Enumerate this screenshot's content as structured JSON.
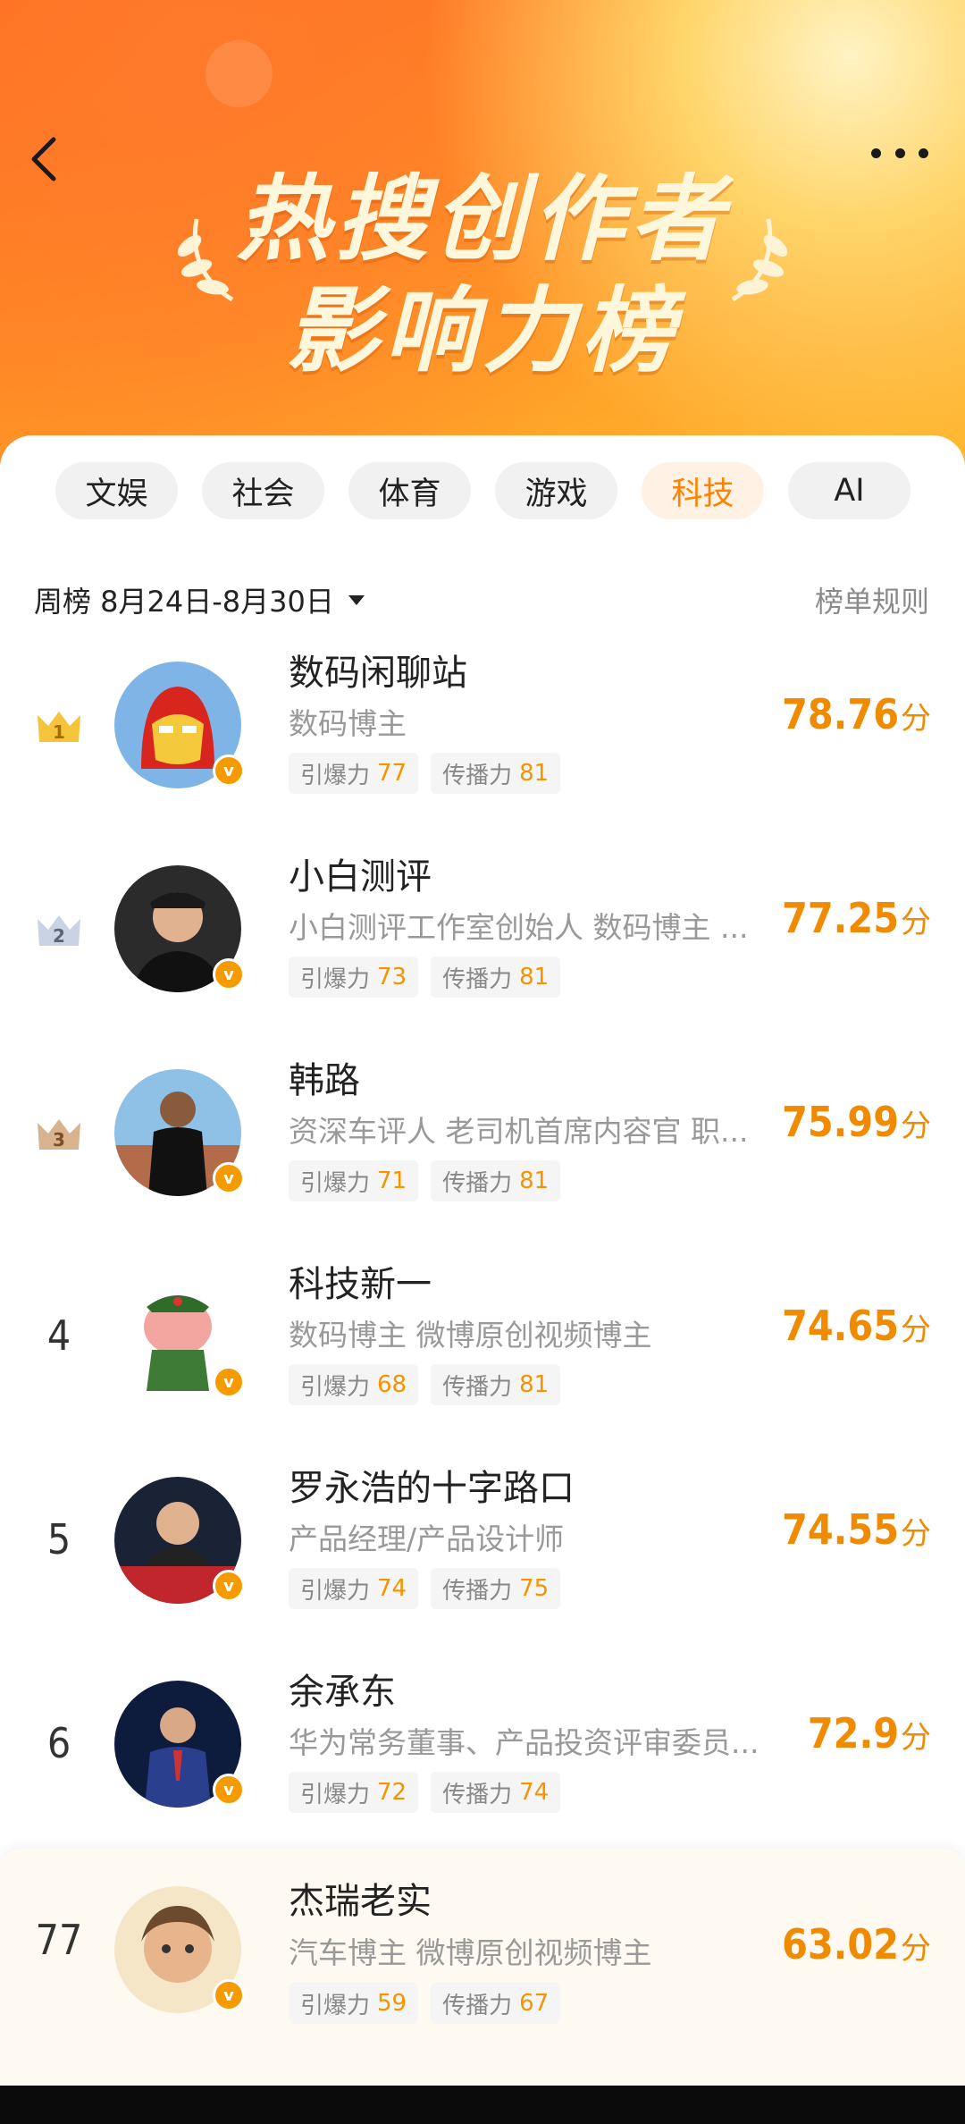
{
  "header": {
    "title_line1": "热搜创作者",
    "title_line2": "影响力榜",
    "back_icon": "chevron-left-icon",
    "more_icon": "more-dots-icon"
  },
  "tabs": [
    {
      "label": "文娱",
      "active": false
    },
    {
      "label": "社会",
      "active": false
    },
    {
      "label": "体育",
      "active": false
    },
    {
      "label": "游戏",
      "active": false
    },
    {
      "label": "科技",
      "active": true
    },
    {
      "label": "AI",
      "active": false
    }
  ],
  "period": {
    "label": "周榜 8月24日-8月30日",
    "rules_label": "榜单规则"
  },
  "labels": {
    "burst": "引爆力",
    "spread": "传播力",
    "score_unit": "分"
  },
  "colors": {
    "accent": "#f08a00",
    "verified": "#f59b00",
    "banner": "#ff8a24"
  },
  "ranking": [
    {
      "rank": "1",
      "name": "数码闲聊站",
      "desc": "数码博主",
      "burst": "77",
      "spread": "81",
      "score": "78.76"
    },
    {
      "rank": "2",
      "name": "小白测评",
      "desc": "小白测评工作室创始人 数码博主 ...",
      "burst": "73",
      "spread": "81",
      "score": "77.25"
    },
    {
      "rank": "3",
      "name": "韩路",
      "desc": "资深车评人 老司机首席内容官 职...",
      "burst": "71",
      "spread": "81",
      "score": "75.99"
    },
    {
      "rank": "4",
      "name": "科技新一",
      "desc": "数码博主 微博原创视频博主",
      "burst": "68",
      "spread": "81",
      "score": "74.65"
    },
    {
      "rank": "5",
      "name": "罗永浩的十字路口",
      "desc": "产品经理/产品设计师",
      "burst": "74",
      "spread": "75",
      "score": "74.55"
    },
    {
      "rank": "6",
      "name": "余承东",
      "desc": "华为常务董事、产品投资评审委员...",
      "burst": "72",
      "spread": "74",
      "score": "72.9"
    }
  ],
  "me": {
    "rank": "77",
    "name": "杰瑞老实",
    "desc": "汽车博主 微博原创视频博主",
    "burst": "59",
    "spread": "67",
    "score": "63.02"
  }
}
